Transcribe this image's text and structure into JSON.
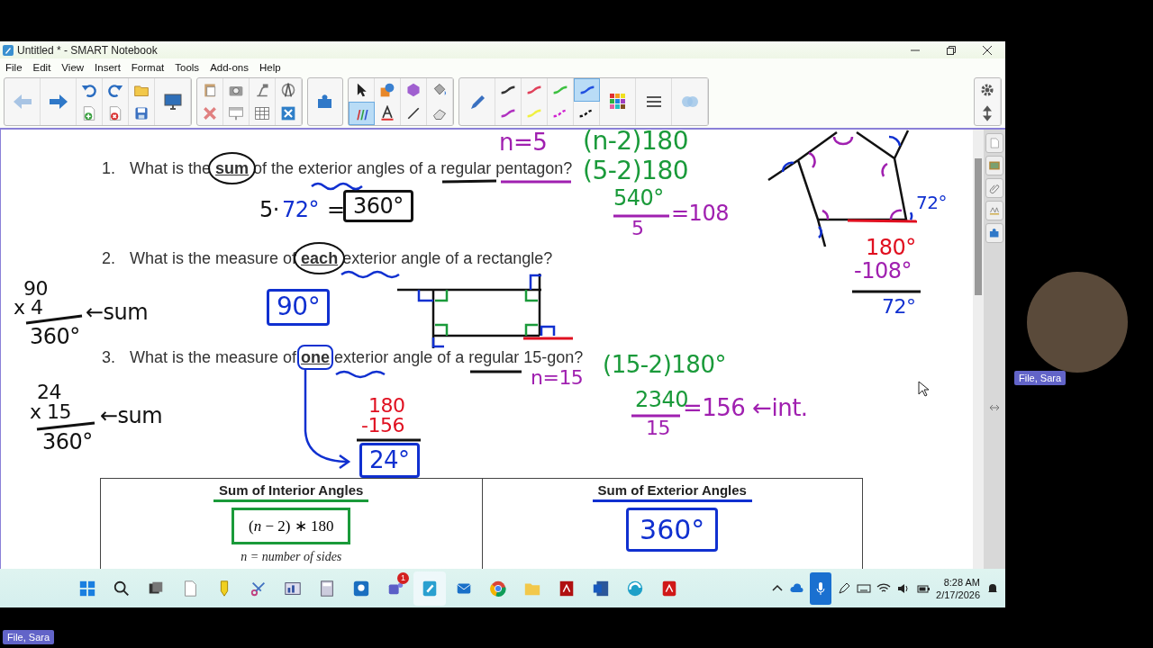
{
  "window": {
    "title": "Untitled * - SMART Notebook"
  },
  "menu": [
    "File",
    "Edit",
    "View",
    "Insert",
    "Format",
    "Tools",
    "Add-ons",
    "Help"
  ],
  "toolbar": {
    "select_tools": [
      {
        "kind": "select",
        "selected": false
      },
      {
        "kind": "shapes",
        "selected": false
      },
      {
        "kind": "polygon",
        "selected": false
      },
      {
        "kind": "fill",
        "selected": false
      },
      {
        "kind": "pens",
        "selected": true
      },
      {
        "kind": "text",
        "selected": false
      },
      {
        "kind": "line",
        "selected": false
      },
      {
        "kind": "eraser",
        "selected": false
      }
    ],
    "line_styles": [
      {
        "color": "#333333",
        "dashed": false,
        "selected": false
      },
      {
        "color": "#e0405a",
        "dashed": false,
        "selected": false
      },
      {
        "color": "#3cc040",
        "dashed": false,
        "selected": false
      },
      {
        "color": "#2050e0",
        "dashed": false,
        "selected": true
      },
      {
        "color": "#b030c0",
        "dashed": false,
        "selected": false
      },
      {
        "color": "#f0f040",
        "dashed": false,
        "selected": false
      },
      {
        "color": "#d020d0",
        "dashed": true,
        "selected": false
      },
      {
        "color": "#111111",
        "dashed": true,
        "selected": false
      }
    ]
  },
  "page": {
    "questions": [
      {
        "number": "1.",
        "text": "What is the **sum** of the exterior angles of a regular pentagon?"
      },
      {
        "number": "2.",
        "text": "What is the measure of **each** exterior angle of a rectangle?"
      },
      {
        "number": "3.",
        "text": "What is the measure of **one** exterior angle of a regular 15-gon?"
      }
    ],
    "ink": [
      {
        "text": "n=5",
        "color": "#a020b0",
        "kind": "text"
      },
      {
        "text": "(n-2)180",
        "color": "#1a9a3a",
        "kind": "text"
      },
      {
        "text": "(5-2)180",
        "color": "#1a9a3a",
        "kind": "text"
      },
      {
        "text": "5·",
        "color": "#111111",
        "kind": "text"
      },
      {
        "text": "72°",
        "color": "#1030d0",
        "kind": "text"
      },
      {
        "text": "=",
        "color": "#111111",
        "kind": "text"
      },
      {
        "text": "360°",
        "color": "#111111",
        "kind": "boxed"
      },
      {
        "text": "540°",
        "color": "#1a9a3a",
        "kind": "text"
      },
      {
        "text": "=108",
        "color": "#a020b0",
        "kind": "text"
      },
      {
        "text": "72°",
        "color": "#1030d0",
        "kind": "text"
      },
      {
        "text": "5",
        "color": "#a020b0",
        "kind": "text"
      },
      {
        "text": "180°",
        "color": "#e01020",
        "kind": "text"
      },
      {
        "text": "-108°",
        "color": "#a020b0",
        "kind": "text"
      },
      {
        "text": "90",
        "color": "#111111",
        "kind": "text"
      },
      {
        "text": "x 4",
        "color": "#111111",
        "kind": "text"
      },
      {
        "text": "←sum",
        "color": "#111111",
        "kind": "text"
      },
      {
        "text": "360°",
        "color": "#111111",
        "kind": "text"
      },
      {
        "text": "90°",
        "color": "#1030d0",
        "kind": "boxed"
      },
      {
        "text": "72°",
        "color": "#1030d0",
        "kind": "text"
      },
      {
        "text": "24",
        "color": "#111111",
        "kind": "text"
      },
      {
        "text": "180",
        "color": "#e01020",
        "kind": "text"
      },
      {
        "text": "n=15",
        "color": "#a020b0",
        "kind": "text"
      },
      {
        "text": "(15-2)180°",
        "color": "#1a9a3a",
        "kind": "text"
      },
      {
        "text": "x 15",
        "color": "#111111",
        "kind": "text"
      },
      {
        "text": "←sum",
        "color": "#111111",
        "kind": "text"
      },
      {
        "text": "-156",
        "color": "#e01020",
        "kind": "text"
      },
      {
        "text": "2340",
        "color": "#1a9a3a",
        "kind": "text"
      },
      {
        "text": "=156 ←int.",
        "color": "#a020b0",
        "kind": "text"
      },
      {
        "text": "15",
        "color": "#a020b0",
        "kind": "text"
      },
      {
        "text": "360°",
        "color": "#111111",
        "kind": "text"
      },
      {
        "text": "24°",
        "color": "#1030d0",
        "kind": "boxed"
      }
    ],
    "table": {
      "columns": [
        {
          "heading": "Sum of Interior Angles",
          "formula": "(*n* − 2) ∗ 180",
          "note": "n = number of sides"
        },
        {
          "heading": "Sum of Exterior Angles",
          "answer": "360°"
        }
      ]
    }
  },
  "taskbar": {
    "notification_badge": "1",
    "time": "8:28 AM",
    "date": "2/17/2026"
  },
  "participant": {
    "name": "File, Sara"
  },
  "presenter_label": "File, Sara"
}
